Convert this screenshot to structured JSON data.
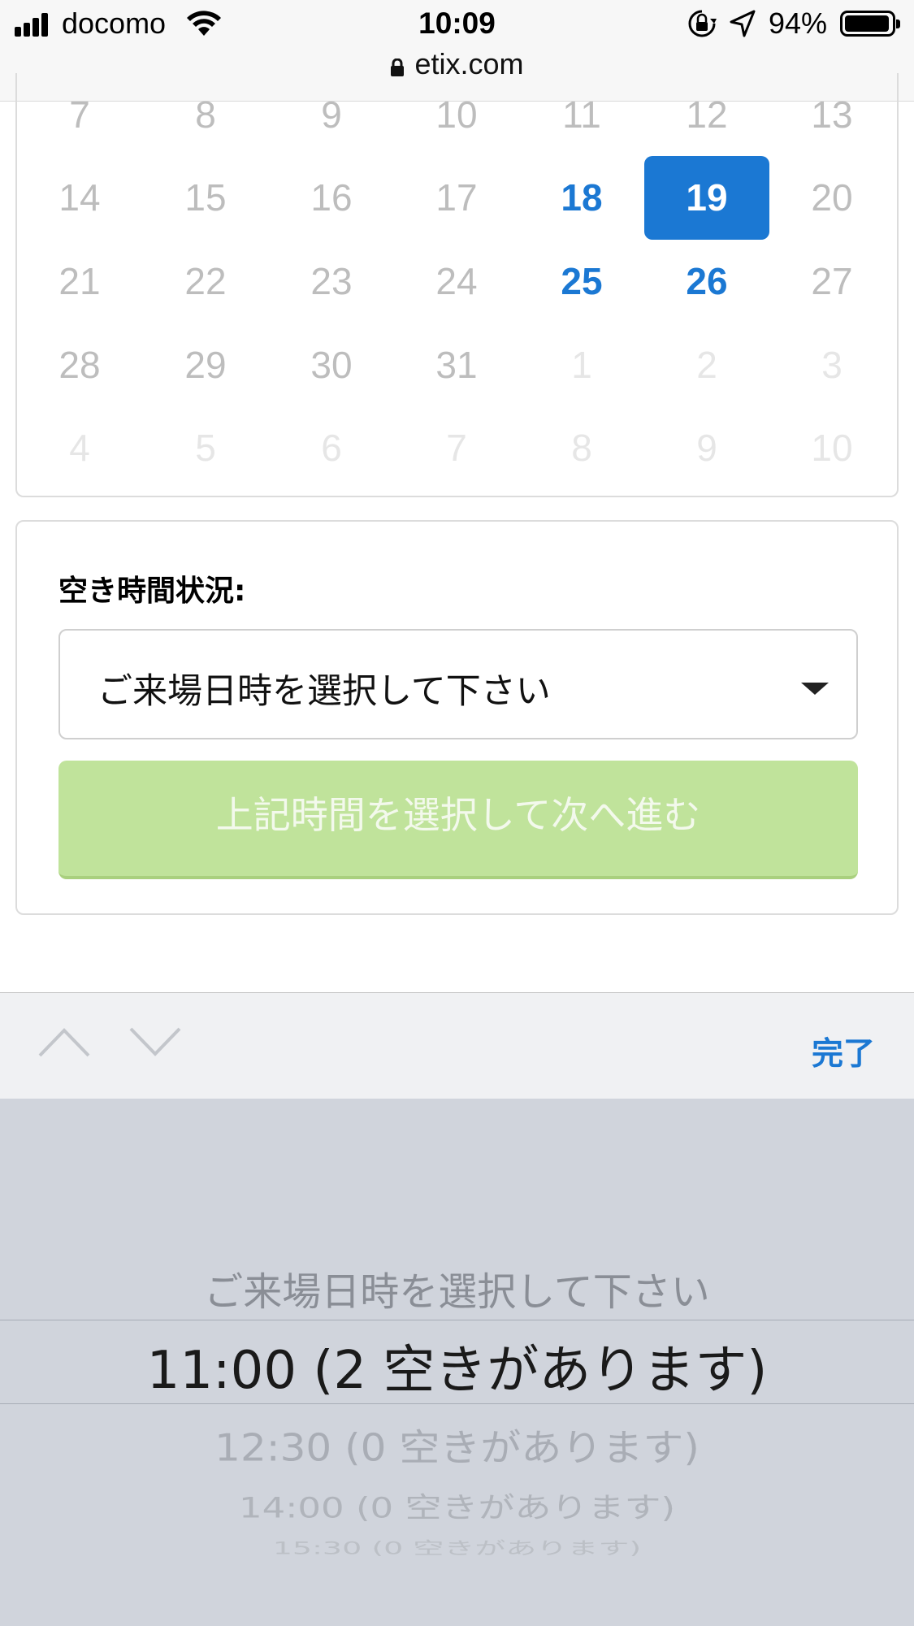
{
  "status_bar": {
    "carrier": "docomo",
    "time": "10:09",
    "battery": "94%",
    "battery_level": 0.94,
    "url": "etix.com"
  },
  "calendar": {
    "rows": [
      [
        {
          "d": "7",
          "s": "dis"
        },
        {
          "d": "8",
          "s": "dis"
        },
        {
          "d": "9",
          "s": "dis"
        },
        {
          "d": "10",
          "s": "dis"
        },
        {
          "d": "11",
          "s": "dis"
        },
        {
          "d": "12",
          "s": "dis"
        },
        {
          "d": "13",
          "s": "dis"
        }
      ],
      [
        {
          "d": "14",
          "s": "dis"
        },
        {
          "d": "15",
          "s": "dis"
        },
        {
          "d": "16",
          "s": "dis"
        },
        {
          "d": "17",
          "s": "dis"
        },
        {
          "d": "18",
          "s": "avail"
        },
        {
          "d": "19",
          "s": "sel"
        },
        {
          "d": "20",
          "s": "dis"
        }
      ],
      [
        {
          "d": "21",
          "s": "dis"
        },
        {
          "d": "22",
          "s": "dis"
        },
        {
          "d": "23",
          "s": "dis"
        },
        {
          "d": "24",
          "s": "dis"
        },
        {
          "d": "25",
          "s": "avail"
        },
        {
          "d": "26",
          "s": "avail"
        },
        {
          "d": "27",
          "s": "dis"
        }
      ],
      [
        {
          "d": "28",
          "s": "dis"
        },
        {
          "d": "29",
          "s": "dis"
        },
        {
          "d": "30",
          "s": "dis"
        },
        {
          "d": "31",
          "s": "dis"
        },
        {
          "d": "1",
          "s": "next"
        },
        {
          "d": "2",
          "s": "next"
        },
        {
          "d": "3",
          "s": "next"
        }
      ],
      [
        {
          "d": "4",
          "s": "next"
        },
        {
          "d": "5",
          "s": "next"
        },
        {
          "d": "6",
          "s": "next"
        },
        {
          "d": "7",
          "s": "next"
        },
        {
          "d": "8",
          "s": "next"
        },
        {
          "d": "9",
          "s": "next"
        },
        {
          "d": "10",
          "s": "next"
        }
      ]
    ]
  },
  "availability": {
    "label": "空き時間状況:",
    "select_value": "ご来場日時を選択して下さい",
    "next_button": "上記時間を選択して次へ進む"
  },
  "accessory": {
    "done": "完了"
  },
  "picker": {
    "options": [
      "ご来場日時を選択して下さい",
      "11:00 (2 空きがあります)",
      "12:30 (0 空きがあります)",
      "14:00 (0 空きがあります)",
      "15:30 (0 空きがあります)"
    ]
  },
  "colors": {
    "accent": "#1b78d3",
    "button_disabled_green": "#c0e39b",
    "picker_bg": "#d0d4dc"
  }
}
